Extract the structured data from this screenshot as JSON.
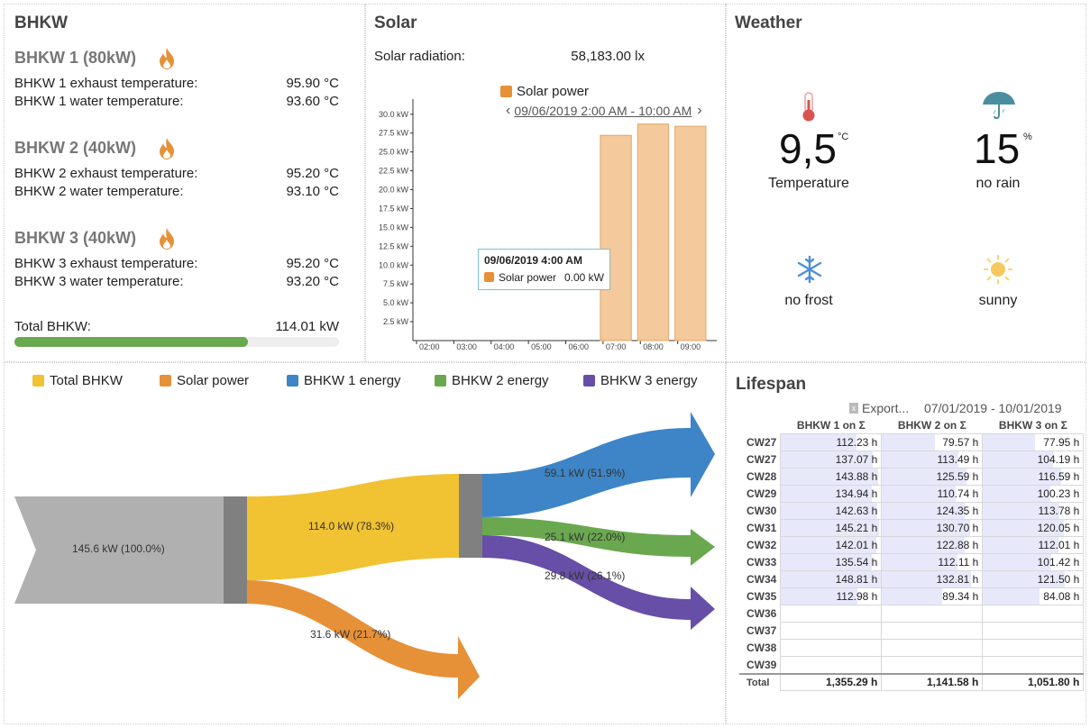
{
  "bhkw": {
    "title": "BHKW",
    "units": [
      {
        "name": "BHKW 1 (80kW)",
        "rows": [
          {
            "label": "BHKW 1 exhaust temperature:",
            "value": "95.90 °C"
          },
          {
            "label": "BHKW 1 water temperature:",
            "value": "93.60 °C"
          }
        ]
      },
      {
        "name": "BHKW 2 (40kW)",
        "rows": [
          {
            "label": "BHKW 2 exhaust temperature:",
            "value": "95.20 °C"
          },
          {
            "label": "BHKW 2 water temperature:",
            "value": "93.10 °C"
          }
        ]
      },
      {
        "name": "BHKW 3 (40kW)",
        "rows": [
          {
            "label": "BHKW 3 exhaust temperature:",
            "value": "95.20 °C"
          },
          {
            "label": "BHKW 3 water temperature:",
            "value": "93.20 °C"
          }
        ]
      }
    ],
    "total_label": "Total BHKW:",
    "total_value": "114.01 kW",
    "total_progress": 0.72,
    "icon": "flame-icon"
  },
  "solar": {
    "title": "Solar",
    "radiation_label": "Solar radiation:",
    "radiation_value": "58,183.00 lx",
    "legend": "Solar power",
    "range": "09/06/2019 2:00 AM - 10:00 AM",
    "tooltip": {
      "title": "09/06/2019 4:00 AM",
      "series": "Solar power",
      "value": "0.00 kW"
    }
  },
  "chart_data": {
    "type": "bar",
    "categories": [
      "02:00",
      "03:00",
      "04:00",
      "05:00",
      "06:00",
      "07:00",
      "08:00",
      "09:00"
    ],
    "series": [
      {
        "name": "Solar power",
        "values": [
          0,
          0,
          0,
          0,
          0,
          27.2,
          28.7,
          28.4
        ]
      }
    ],
    "yticks": [
      "2.5 kW",
      "5.0 kW",
      "7.5 kW",
      "10.0 kW",
      "12.5 kW",
      "15.0 kW",
      "17.5 kW",
      "20.0 kW",
      "22.5 kW",
      "25.0 kW",
      "27.5 kW",
      "30.0 kW"
    ],
    "ylim": [
      0,
      32
    ],
    "color": "#f4c99b"
  },
  "weather": {
    "title": "Weather",
    "temperature": {
      "value": "9,5",
      "unit": "°C",
      "label": "Temperature",
      "icon": "thermometer-icon"
    },
    "rain": {
      "value": "15",
      "unit": "%",
      "label": "no rain",
      "icon": "umbrella-icon"
    },
    "frost": {
      "label": "no frost",
      "icon": "snowflake-icon"
    },
    "sun": {
      "label": "sunny",
      "icon": "sun-icon"
    }
  },
  "sankey": {
    "legend": [
      {
        "label": "Total BHKW",
        "color": "#f1c232"
      },
      {
        "label": "Solar power",
        "color": "#e69138"
      },
      {
        "label": "BHKW 1 energy",
        "color": "#3d85c6"
      },
      {
        "label": "BHKW 2 energy",
        "color": "#6aa84f"
      },
      {
        "label": "BHKW 3 energy",
        "color": "#674ea7"
      }
    ],
    "flows": {
      "source": "145.6 kW  (100.0%)",
      "total_bhkw": "114.0 kW  (78.3%)",
      "solar": "31.6 kW  (21.7%)",
      "bhkw1": "59.1 kW  (51.9%)",
      "bhkw2": "25.1 kW  (22.0%)",
      "bhkw3": "29.8 kW  (26.1%)"
    }
  },
  "lifespan": {
    "title": "Lifespan",
    "export": "Export...",
    "range": "07/01/2019 - 10/01/2019",
    "columns": [
      "BHKW 1 on Σ",
      "BHKW 2 on Σ",
      "BHKW 3 on Σ"
    ],
    "rows": [
      {
        "label": "CW27",
        "values": [
          "112.23 h",
          "79.57 h",
          "77.95 h"
        ],
        "fill": [
          0.75,
          0.53,
          0.52
        ]
      },
      {
        "label": "CW27",
        "values": [
          "137.07 h",
          "113.49 h",
          "104.19 h"
        ],
        "fill": [
          0.92,
          0.76,
          0.7
        ]
      },
      {
        "label": "CW28",
        "values": [
          "143.88 h",
          "125.59 h",
          "116.59 h"
        ],
        "fill": [
          0.97,
          0.84,
          0.78
        ]
      },
      {
        "label": "CW29",
        "values": [
          "134.94 h",
          "110.74 h",
          "100.23 h"
        ],
        "fill": [
          0.91,
          0.74,
          0.67
        ]
      },
      {
        "label": "CW30",
        "values": [
          "142.63 h",
          "124.35 h",
          "113.78 h"
        ],
        "fill": [
          0.96,
          0.83,
          0.76
        ]
      },
      {
        "label": "CW31",
        "values": [
          "145.21 h",
          "130.70 h",
          "120.05 h"
        ],
        "fill": [
          0.98,
          0.88,
          0.81
        ]
      },
      {
        "label": "CW32",
        "values": [
          "142.01 h",
          "122.88 h",
          "112.01 h"
        ],
        "fill": [
          0.95,
          0.83,
          0.75
        ]
      },
      {
        "label": "CW33",
        "values": [
          "135.54 h",
          "112.11 h",
          "101.42 h"
        ],
        "fill": [
          0.91,
          0.75,
          0.68
        ]
      },
      {
        "label": "CW34",
        "values": [
          "148.81 h",
          "132.81 h",
          "121.50 h"
        ],
        "fill": [
          1.0,
          0.89,
          0.82
        ]
      },
      {
        "label": "CW35",
        "values": [
          "112.98 h",
          "89.34 h",
          "84.08 h"
        ],
        "fill": [
          0.76,
          0.6,
          0.56
        ]
      },
      {
        "label": "CW36",
        "values": [
          "",
          "",
          ""
        ],
        "fill": [
          0,
          0,
          0
        ]
      },
      {
        "label": "CW37",
        "values": [
          "",
          "",
          ""
        ],
        "fill": [
          0,
          0,
          0
        ]
      },
      {
        "label": "CW38",
        "values": [
          "",
          "",
          ""
        ],
        "fill": [
          0,
          0,
          0
        ]
      },
      {
        "label": "CW39",
        "values": [
          "",
          "",
          ""
        ],
        "fill": [
          0,
          0,
          0
        ]
      }
    ],
    "total": {
      "label": "Total",
      "values": [
        "1,355.29 h",
        "1,141.58 h",
        "1,051.80 h"
      ]
    }
  }
}
